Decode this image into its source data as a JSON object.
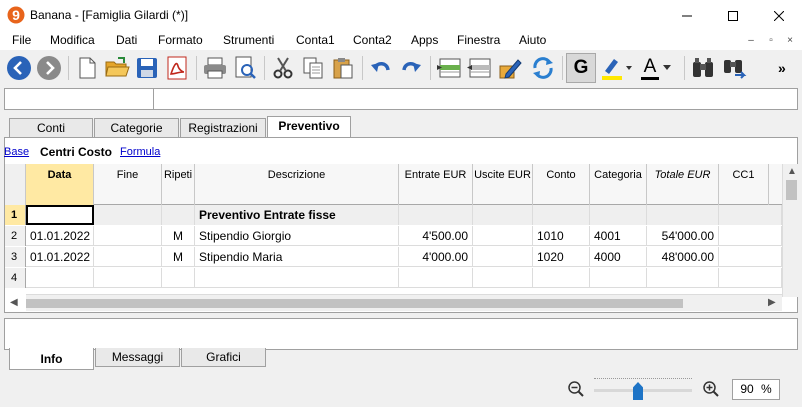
{
  "window": {
    "title": "Banana - [Famiglia Gilardi (*)]",
    "logo_glyph": "9"
  },
  "menu": [
    "File",
    "Modifica",
    "Dati",
    "Formato",
    "Strumenti",
    "Conta1",
    "Conta2",
    "Apps",
    "Finestra",
    "Aiuto"
  ],
  "toolbar": {
    "bold_glyph": "G",
    "font_color_glyph": "A",
    "overflow": "»"
  },
  "tabs": [
    "Conti",
    "Categorie",
    "Registrazioni",
    "Preventivo"
  ],
  "active_tab": "Preventivo",
  "views": [
    "Base",
    "Centri Costo",
    "Formula"
  ],
  "active_view": "Centri Costo",
  "columns": [
    "Data",
    "Fine",
    "Ripeti",
    "Descrizione",
    "Entrate EUR",
    "Uscite EUR",
    "Conto",
    "Categoria",
    "Totale EUR",
    "CC1"
  ],
  "rows": [
    {
      "n": "1",
      "data": "",
      "fine": "",
      "ripeti": "",
      "descrizione": "Preventivo Entrate fisse",
      "entrate": "",
      "uscite": "",
      "conto": "",
      "categoria": "",
      "totale": "",
      "cc1": ""
    },
    {
      "n": "2",
      "data": "01.01.2022",
      "fine": "",
      "ripeti": "M",
      "descrizione": "Stipendio Giorgio",
      "entrate": "4'500.00",
      "uscite": "",
      "conto": "1010",
      "categoria": "4001",
      "totale": "54'000.00",
      "cc1": ""
    },
    {
      "n": "3",
      "data": "01.01.2022",
      "fine": "",
      "ripeti": "M",
      "descrizione": "Stipendio Maria",
      "entrate": "4'000.00",
      "uscite": "",
      "conto": "1020",
      "categoria": "4000",
      "totale": "48'000.00",
      "cc1": ""
    },
    {
      "n": "4",
      "data": "",
      "fine": "",
      "ripeti": "",
      "descrizione": "",
      "entrate": "",
      "uscite": "",
      "conto": "",
      "categoria": "",
      "totale": "",
      "cc1": ""
    }
  ],
  "bottom_tabs": [
    "Info",
    "Messaggi",
    "Grafici"
  ],
  "active_bottom_tab": "Info",
  "zoom": {
    "value": "90",
    "unit": "%",
    "level": 0.45
  },
  "colors": {
    "accent": "#1e74c6",
    "selected_header": "#ffe9a3",
    "logo": "#e8641b"
  }
}
